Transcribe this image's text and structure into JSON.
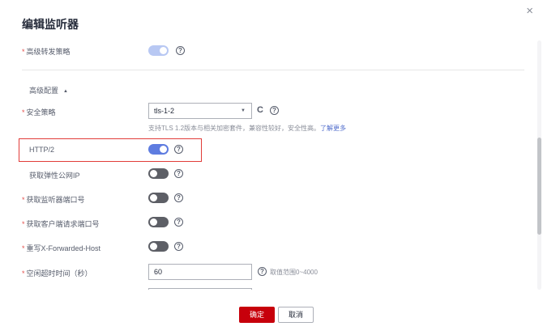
{
  "dialog": {
    "title": "编辑监听器",
    "close_glyph": "×"
  },
  "fields": {
    "advanced_forwarding": {
      "label": "高级转发策略",
      "required": "*"
    },
    "advanced_config": {
      "label": "高级配置",
      "caret": "▲"
    },
    "security_policy": {
      "label": "安全策略",
      "required": "*",
      "value": "tls-1-2",
      "caret": "▼",
      "refresh_glyph": "C",
      "hint": "支持TLS 1.2版本与相关加密套件，兼容性较好，安全性高。",
      "hint_link": "了解更多"
    },
    "http2": {
      "label": "HTTP/2"
    },
    "get_eip": {
      "label": "获取弹性公网IP"
    },
    "get_listener_port": {
      "label": "获取监听器端口号",
      "required": "*"
    },
    "get_client_port": {
      "label": "获取客户端请求端口号",
      "required": "*"
    },
    "rewrite_xfh": {
      "label": "重写X-Forwarded-Host",
      "required": "*"
    },
    "idle_timeout": {
      "label": "空闲超时时间（秒）",
      "required": "*",
      "value": "60",
      "hint": "取值范围0~4000"
    }
  },
  "help_glyph": "?",
  "footer": {
    "ok_label": "确定",
    "cancel_label": "取消"
  },
  "colors": {
    "accent": "#5e7ce0",
    "primary_button": "#c7000b",
    "highlight_border": "#e13c39",
    "required_star": "#e4504e"
  }
}
